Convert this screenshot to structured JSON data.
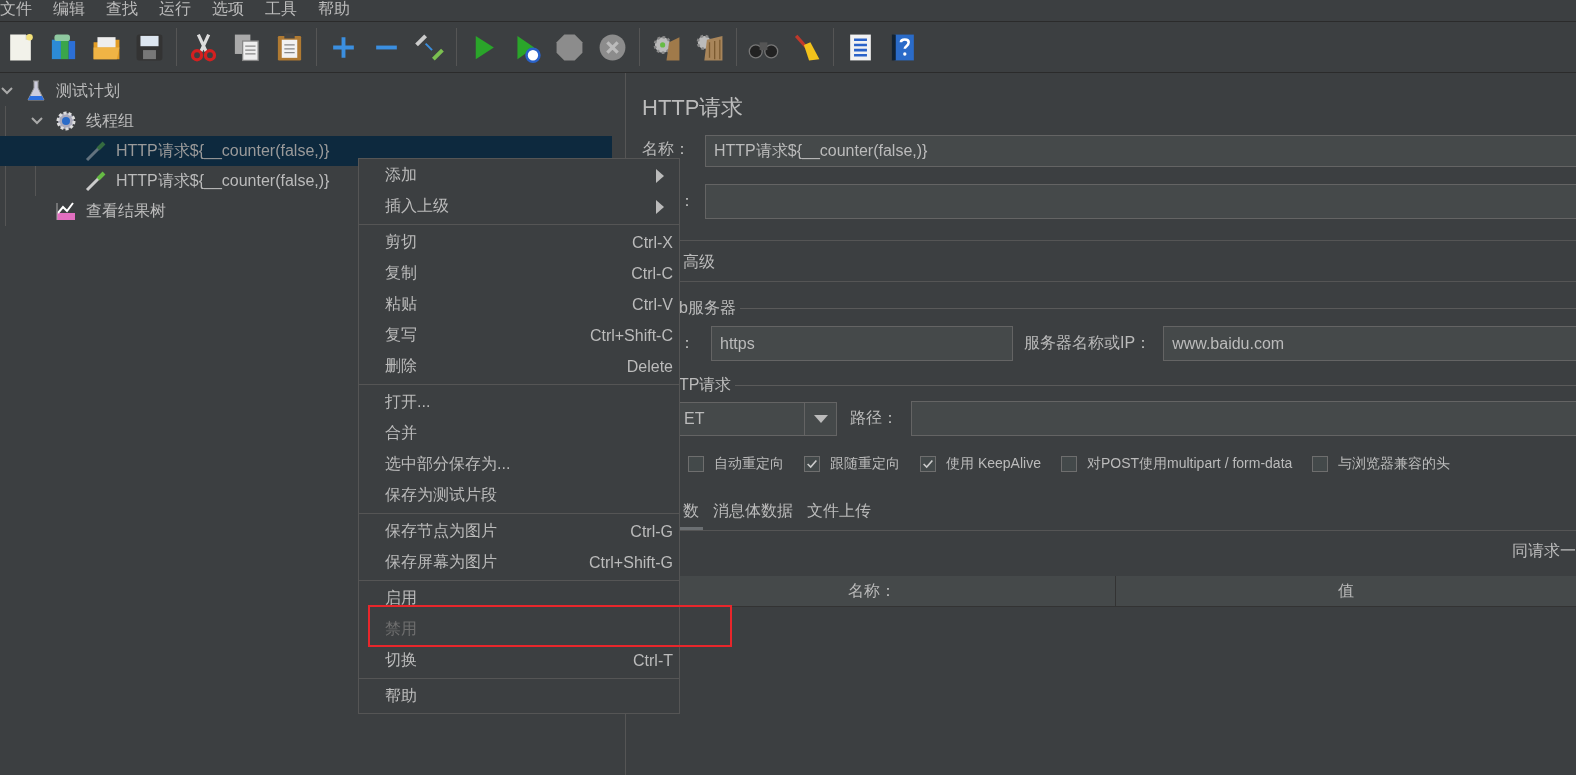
{
  "menubar": [
    "文件",
    "编辑",
    "查找",
    "运行",
    "选项",
    "工具",
    "帮助"
  ],
  "tree": [
    {
      "label": "测试计划",
      "kind": "test-plan",
      "expanded": true,
      "selected": false,
      "disabled": false,
      "children": [
        {
          "label": "线程组",
          "kind": "thread-group",
          "expanded": true,
          "selected": false,
          "disabled": false,
          "children": [
            {
              "label": "HTTP请求${__counter(false,)}",
              "kind": "sampler",
              "selected": true,
              "disabled": true
            },
            {
              "label": "HTTP请求${__counter(false,)}",
              "kind": "sampler",
              "selected": false,
              "disabled": false
            }
          ]
        },
        {
          "label": "查看结果树",
          "kind": "listener",
          "selected": false,
          "disabled": false
        }
      ]
    }
  ],
  "editor": {
    "title": "HTTP请求",
    "name_field": {
      "label": "名称：",
      "value": "HTTP请求${__counter(false,)}"
    },
    "comment_field": {
      "label": "："
    },
    "top_tabs": [
      {
        "label": "高级",
        "selected": false
      }
    ],
    "web_server": {
      "title": "b服务器",
      "protocol_label": "：",
      "protocol": "https",
      "server_label": "服务器名称或IP：",
      "server": "www.baidu.com"
    },
    "http_request": {
      "title": "TP请求",
      "method": "ET",
      "path_label": "路径："
    },
    "options": [
      {
        "label": "自动重定向",
        "checked": false
      },
      {
        "label": "跟随重定向",
        "checked": true
      },
      {
        "label": "使用 KeepAlive",
        "checked": true
      },
      {
        "label": "对POST使用multipart / form-data",
        "checked": false
      },
      {
        "label": "与浏览器兼容的头",
        "checked": false
      }
    ],
    "body_tabs": [
      {
        "label": "数",
        "selected": true
      },
      {
        "label": "消息体数据",
        "selected": false
      },
      {
        "label": "文件上传",
        "selected": false
      }
    ],
    "table": {
      "note": "同请求一",
      "columns": [
        "名称：",
        "值"
      ]
    }
  },
  "context_menu": [
    [
      {
        "label": "添加",
        "kind": "submenu",
        "disabled": false
      },
      {
        "label": "插入上级",
        "kind": "submenu",
        "disabled": false
      }
    ],
    [
      {
        "label": "剪切",
        "kind": "command",
        "shortcut": "Ctrl-X",
        "disabled": false
      },
      {
        "label": "复制",
        "kind": "command",
        "shortcut": "Ctrl-C",
        "disabled": false
      },
      {
        "label": "粘贴",
        "kind": "command",
        "shortcut": "Ctrl-V",
        "disabled": false
      },
      {
        "label": "复写",
        "kind": "command",
        "shortcut": "Ctrl+Shift-C",
        "disabled": false
      },
      {
        "label": "删除",
        "kind": "command",
        "shortcut": "Delete",
        "disabled": false
      }
    ],
    [
      {
        "label": "打开...",
        "kind": "command",
        "disabled": false
      },
      {
        "label": "合并",
        "kind": "command",
        "disabled": false
      },
      {
        "label": "选中部分保存为...",
        "kind": "command",
        "disabled": false
      },
      {
        "label": "保存为测试片段",
        "kind": "command",
        "disabled": false
      }
    ],
    [
      {
        "label": "保存节点为图片",
        "kind": "command",
        "shortcut": "Ctrl-G",
        "disabled": false
      },
      {
        "label": "保存屏幕为图片",
        "kind": "command",
        "shortcut": "Ctrl+Shift-G",
        "disabled": false
      }
    ],
    [
      {
        "label": "启用",
        "kind": "command",
        "disabled": false
      },
      {
        "label": "禁用",
        "kind": "command",
        "disabled": true
      },
      {
        "label": "切换",
        "kind": "command",
        "shortcut": "Ctrl-T",
        "disabled": false
      }
    ],
    [
      {
        "label": "帮助",
        "kind": "command",
        "disabled": false
      }
    ]
  ],
  "annotations": [
    {
      "kind": "highlight-box"
    }
  ]
}
